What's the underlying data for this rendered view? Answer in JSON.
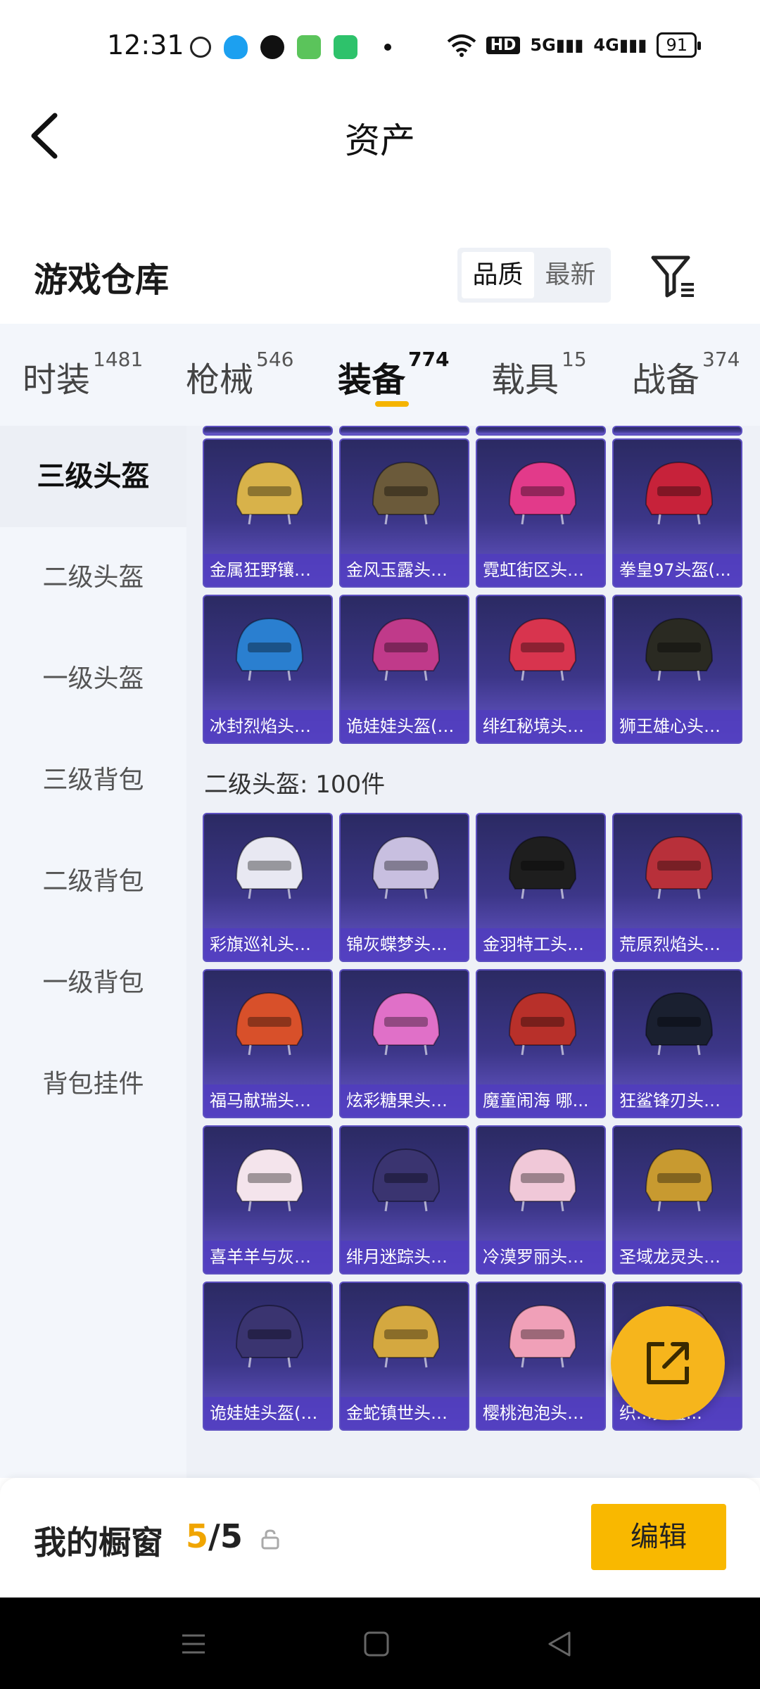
{
  "status_bar": {
    "time": "12:31",
    "network_badge": "HD",
    "signal_1": "5G",
    "signal_2": "4G",
    "battery": "91"
  },
  "nav": {
    "title": "资产"
  },
  "header": {
    "title": "游戏仓库",
    "sort_options": [
      "品质",
      "最新"
    ],
    "active_sort": "品质"
  },
  "tabs": [
    {
      "label": "时装",
      "count": "1481"
    },
    {
      "label": "枪械",
      "count": "546"
    },
    {
      "label": "装备",
      "count": "774"
    },
    {
      "label": "载具",
      "count": "15"
    },
    {
      "label": "战备",
      "count": "374"
    }
  ],
  "sidebar": {
    "items": [
      "三级头盔",
      "二级头盔",
      "一级头盔",
      "三级背包",
      "二级背包",
      "一级背包",
      "背包挂件"
    ]
  },
  "section_level3": {
    "items": [
      {
        "name": "金属狂野镶钻...",
        "color": "#d8b24a"
      },
      {
        "name": "金风玉露头盔...",
        "color": "#6b5a3a"
      },
      {
        "name": "霓虹街区头盔...",
        "color": "#e23a8a"
      },
      {
        "name": "拳皇97头盔(...",
        "color": "#c7223a"
      },
      {
        "name": "冰封烈焰头盔...",
        "color": "#2a7fd0"
      },
      {
        "name": "诡娃娃头盔(3...",
        "color": "#c03a8a"
      },
      {
        "name": "绯红秘境头盔...",
        "color": "#d8344e"
      },
      {
        "name": "狮王雄心头盔...",
        "color": "#2a2a22"
      }
    ]
  },
  "section_level2": {
    "label": "二级头盔: 100件",
    "items": [
      {
        "name": "彩旗巡礼头盔...",
        "color": "#e8e8f2"
      },
      {
        "name": "锦灰蝶梦头盔...",
        "color": "#c8bfe0"
      },
      {
        "name": "金羽特工头盔...",
        "color": "#1e1e1e"
      },
      {
        "name": "荒原烈焰头盔...",
        "color": "#b8303a"
      },
      {
        "name": "福马献瑞头盔...",
        "color": "#d8502a"
      },
      {
        "name": "炫彩糖果头盔...",
        "color": "#e070c8"
      },
      {
        "name": "魔童闹海 哪...",
        "color": "#b8302a"
      },
      {
        "name": "狂鲨锋刃头盔...",
        "color": "#1a2030"
      },
      {
        "name": "喜羊羊与灰太...",
        "color": "#f4e4ec"
      },
      {
        "name": "绯月迷踪头盔...",
        "color": "#3a3470"
      },
      {
        "name": "冷漠罗丽头盔...",
        "color": "#f0c8d8"
      },
      {
        "name": "圣域龙灵头盔...",
        "color": "#c89a30"
      },
      {
        "name": "诡娃娃头盔(2...",
        "color": "#3a3470"
      },
      {
        "name": "金蛇镇世头盔...",
        "color": "#d4a840"
      },
      {
        "name": "樱桃泡泡头盔...",
        "color": "#f0a0b8"
      },
      {
        "name": "织...头盔...",
        "color": "#5a4a9a"
      }
    ]
  },
  "bottom_bar": {
    "label": "我的橱窗",
    "count_current": "5",
    "count_sep_total": "/5",
    "edit_label": "编辑"
  }
}
